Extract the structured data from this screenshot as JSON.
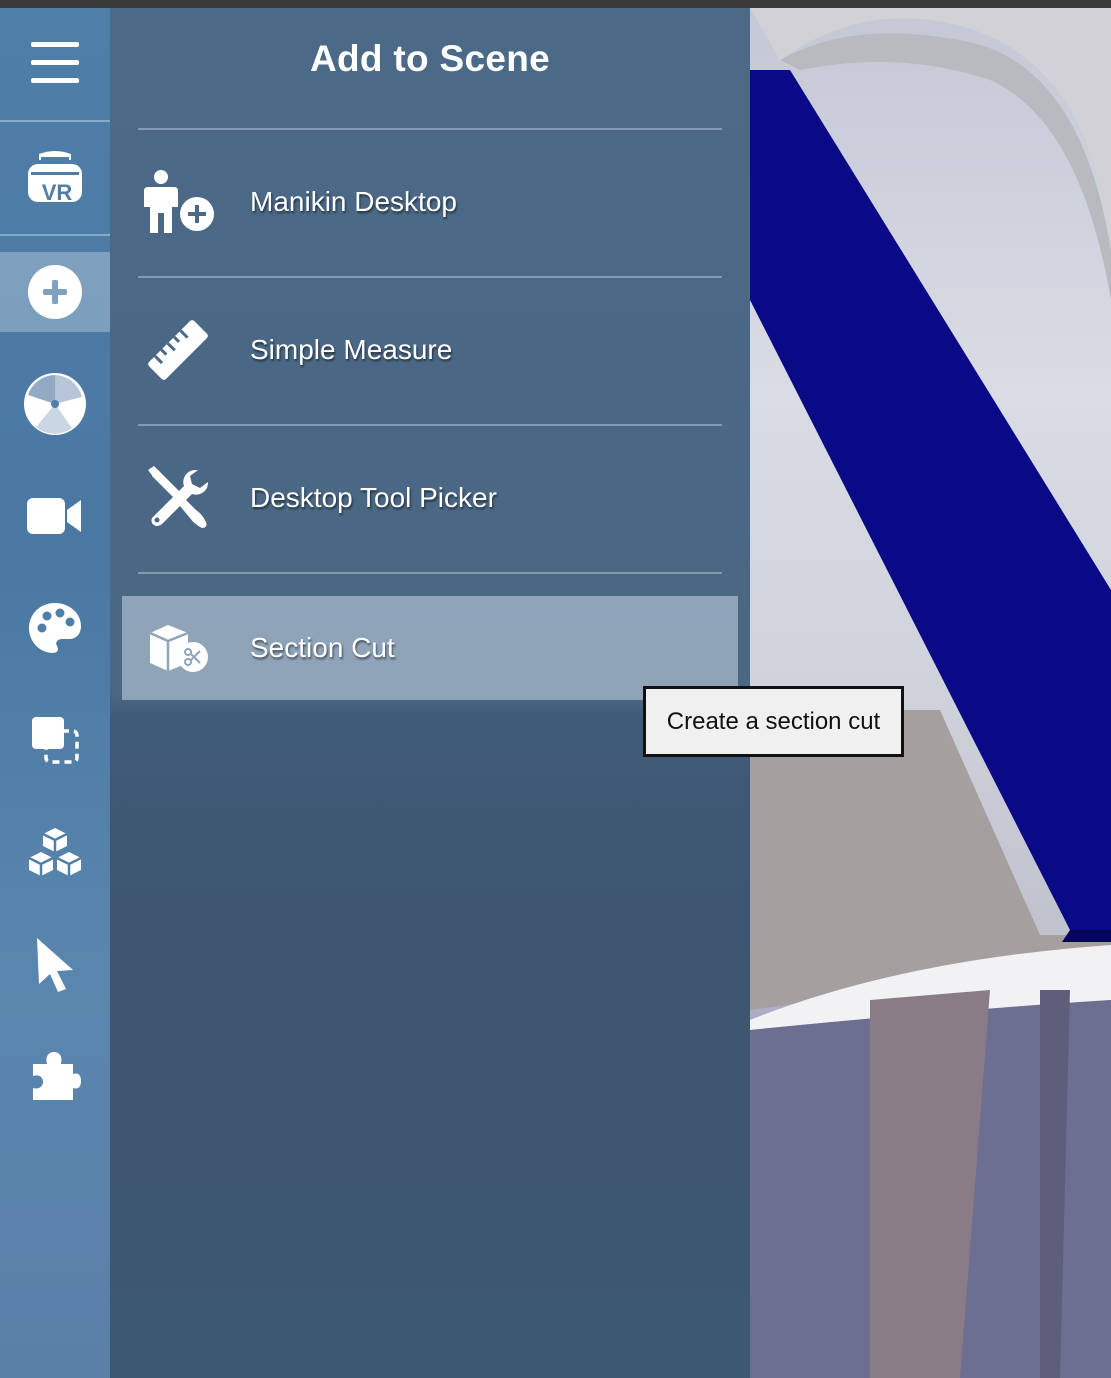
{
  "panel": {
    "title": "Add to Scene",
    "items": [
      {
        "label": "Manikin Desktop",
        "icon": "manikin-add-icon"
      },
      {
        "label": "Simple Measure",
        "icon": "ruler-icon"
      },
      {
        "label": "Desktop Tool Picker",
        "icon": "tools-icon"
      },
      {
        "label": "Section Cut",
        "icon": "section-cut-icon"
      }
    ]
  },
  "tooltip": {
    "text": "Create a section cut"
  },
  "rail": {
    "buttons": [
      "menu-icon",
      "vr-headset-icon",
      "add-icon",
      "pie-chart-icon",
      "video-camera-icon",
      "palette-icon",
      "selection-icon",
      "cubes-icon",
      "pointer-icon",
      "puzzle-icon"
    ],
    "active": "add-icon"
  },
  "colors": {
    "rail": "#4f7ea8",
    "panel": "#4b6a87",
    "highlight": "#8fa5bb",
    "scene_accent": "#0a0a8a"
  }
}
